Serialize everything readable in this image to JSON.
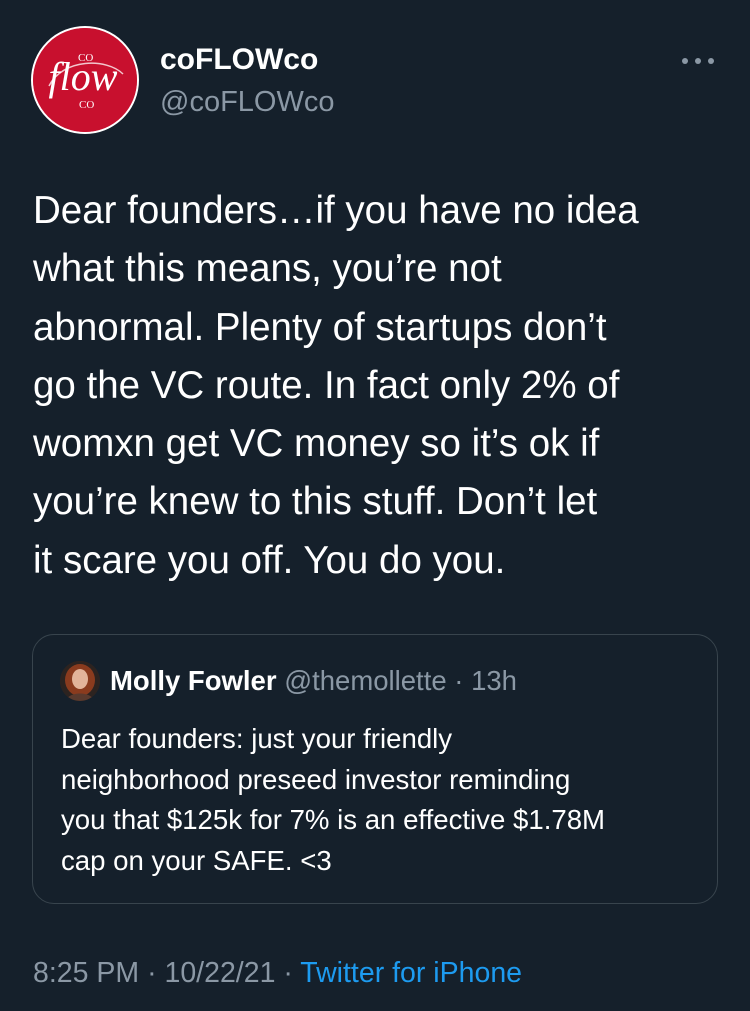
{
  "colors": {
    "background": "#15202b",
    "text_primary": "#ffffff",
    "text_secondary": "#8b98a5",
    "link": "#1d9bf0",
    "border": "#38444d",
    "avatar_brand": "#c8102e"
  },
  "author": {
    "display_name": "coFLOWco",
    "handle": "@coFLOWco",
    "avatar_logo": "flow",
    "avatar_small_top": "CO",
    "avatar_small_bottom": "CO",
    "more_icon": "more-horizontal-icon"
  },
  "tweet": {
    "text": "Dear founders…if you have no idea\nwhat this means, you’re not\nabnormal. Plenty of startups don’t\ngo the VC route. In fact only 2% of\nwomxn get VC money so it’s ok if\nyou’re knew to this stuff. Don’t let\nit scare you off. You do you."
  },
  "quoted_tweet": {
    "display_name": "Molly Fowler",
    "handle": "@themollette",
    "separator": "·",
    "time": "13h",
    "text": "Dear founders: just your friendly\nneighborhood preseed investor reminding\nyou that $125k for 7% is an effective $1.78M\ncap on your SAFE. <3"
  },
  "footer": {
    "time": "8:25 PM",
    "sep1": "·",
    "date": "10/22/21",
    "sep2": "·",
    "source": "Twitter for iPhone"
  }
}
